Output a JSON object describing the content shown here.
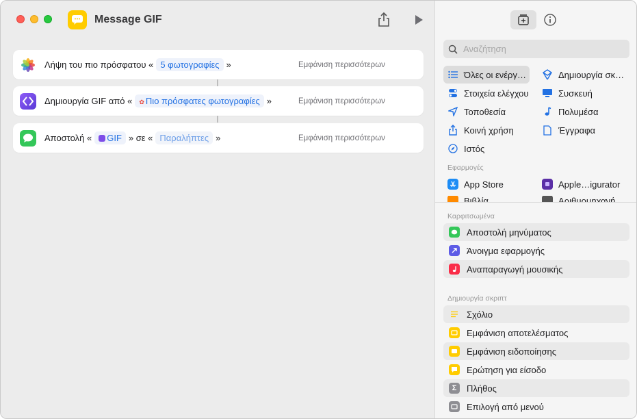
{
  "window": {
    "title": "Message GIF"
  },
  "toolbar": {
    "share_icon": "share-icon",
    "run_icon": "play-icon"
  },
  "actions": [
    {
      "pre": "Λήψη του πιο πρόσφατου «",
      "token": "5 φωτογραφίες",
      "post": "»",
      "more": "Εμφάνιση περισσότερων",
      "icon": "photos-icon"
    },
    {
      "pre": "Δημιουργία GIF από «",
      "token": "Πιο πρόσφατες φωτογραφίες",
      "post": "»",
      "more": "Εμφάνιση περισσότερων",
      "icon": "shortcuts-icon"
    },
    {
      "pre": "Αποστολή «",
      "token": "GIF",
      "mid": "» σε «",
      "token2": "Παραλήπτες",
      "post": "»",
      "more": "Εμφάνιση περισσότερων",
      "icon": "messages-icon"
    }
  ],
  "sidebar": {
    "search_placeholder": "Αναζήτηση",
    "categories": [
      {
        "label": "Όλες οι ενέργ…",
        "icon": "list-icon",
        "color": "#2271e3"
      },
      {
        "label": "Δημιουργία σκ…",
        "icon": "scripting-icon",
        "color": "#2271e3"
      },
      {
        "label": "Στοιχεία ελέγχου",
        "icon": "controls-icon",
        "color": "#2271e3"
      },
      {
        "label": "Συσκευή",
        "icon": "device-icon",
        "color": "#2271e3"
      },
      {
        "label": "Τοποθεσία",
        "icon": "location-icon",
        "color": "#2271e3"
      },
      {
        "label": "Πολυμέσα",
        "icon": "music-note-icon",
        "color": "#2271e3"
      },
      {
        "label": "Κοινή χρήση",
        "icon": "share-icon",
        "color": "#2271e3"
      },
      {
        "label": "Έγγραφα",
        "icon": "document-icon",
        "color": "#2271e3"
      },
      {
        "label": "Ιστός",
        "icon": "compass-icon",
        "color": "#2271e3"
      }
    ],
    "apps_label": "Εφαρμογές",
    "apps": [
      {
        "label": "App Store",
        "icon": "app-store-icon"
      },
      {
        "label": "Apple…igurator",
        "icon": "configurator-icon"
      },
      {
        "label": "Βιβλία",
        "icon": "books-icon"
      },
      {
        "label": "Αριθμομηχανή",
        "icon": "calculator-icon"
      }
    ],
    "pinned_label": "Καρφιτσωμένα",
    "pinned": [
      {
        "label": "Αποστολή μηνύματος",
        "icon": "messages-icon",
        "color": "#34c759"
      },
      {
        "label": "Άνοιγμα εφαρμογής",
        "icon": "open-app-icon",
        "color": "#5e5ce6"
      },
      {
        "label": "Αναπαραγωγή μουσικής",
        "icon": "music-icon",
        "color": "#fa2d48"
      }
    ],
    "scripting_label": "Δημιουργία σκριπτ",
    "scripting": [
      {
        "label": "Σχόλιο",
        "icon": "comment-icon",
        "color": "#ffcc00"
      },
      {
        "label": "Εμφάνιση αποτελέσματος",
        "icon": "show-result-icon",
        "color": "#ffcc00"
      },
      {
        "label": "Εμφάνιση ειδοποίησης",
        "icon": "alert-icon",
        "color": "#ffcc00"
      },
      {
        "label": "Ερώτηση για είσοδο",
        "icon": "ask-input-icon",
        "color": "#ffcc00"
      },
      {
        "label": "Πλήθος",
        "icon": "sigma-icon",
        "color": "#8e8e93"
      },
      {
        "label": "Επιλογή από μενού",
        "icon": "menu-icon",
        "color": "#8e8e93"
      }
    ]
  }
}
